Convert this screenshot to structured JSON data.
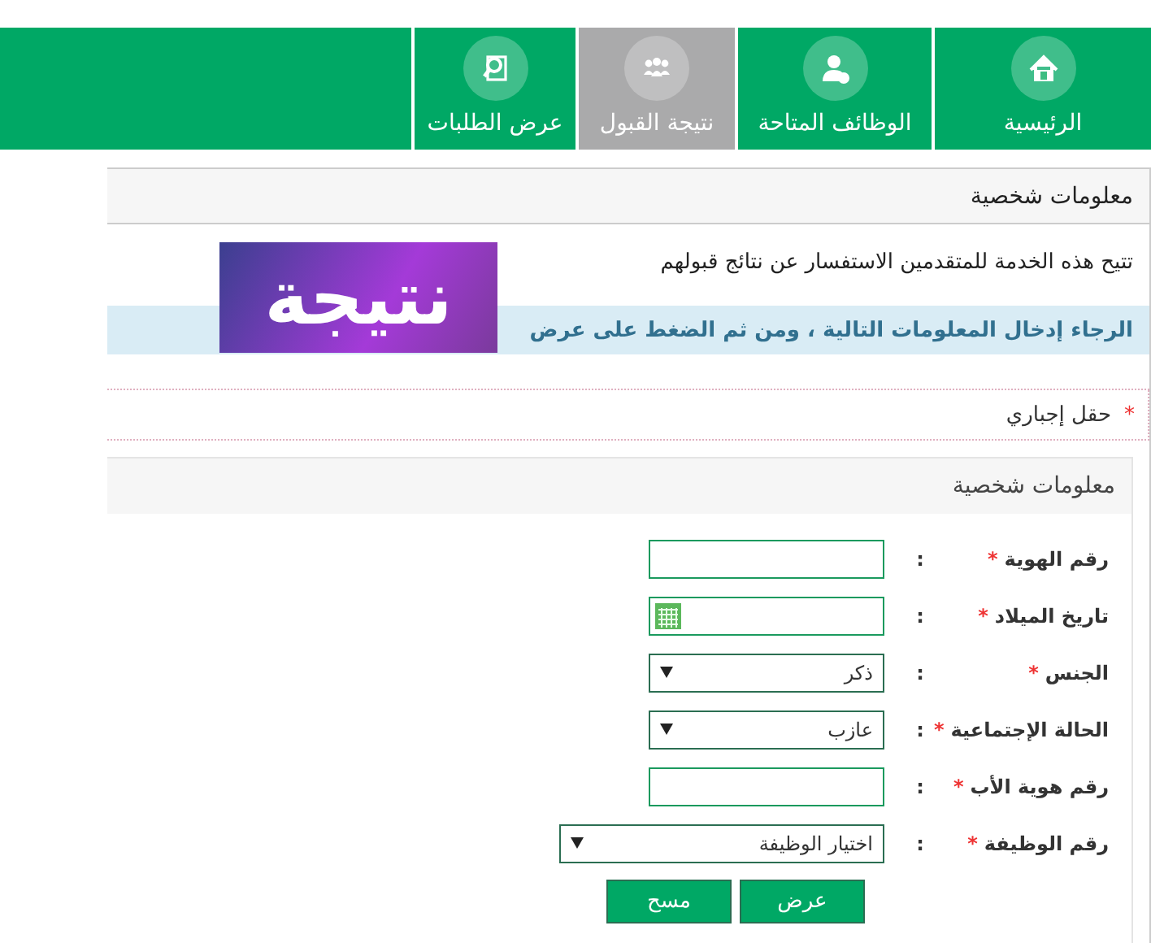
{
  "nav": {
    "items": [
      {
        "label": "الرئيسية",
        "kind": "home",
        "selected": false
      },
      {
        "label": "الوظائف المتاحة",
        "kind": "user",
        "selected": false
      },
      {
        "label": "نتيجة القبول",
        "kind": "group",
        "selected": true
      },
      {
        "label": "عرض الطلبات",
        "kind": "search",
        "selected": false
      }
    ]
  },
  "panel": {
    "title": "معلومات شخصية",
    "intro": "تتيح هذه الخدمة للمتقدمين الاستفسار عن نتائج قبولهم",
    "info": "الرجاء إدخال المعلومات التالية ، ومن ثم الضغط على عرض",
    "logo_text": "نتيجة",
    "required_note": {
      "mark": "*",
      "text": "حقل إجباري"
    }
  },
  "form": {
    "title": "معلومات شخصية",
    "fields": [
      {
        "label": "رقم الهوية",
        "required": true,
        "kind": "text"
      },
      {
        "label": "تاريخ الميلاد",
        "required": true,
        "kind": "date"
      },
      {
        "label": "الجنس",
        "required": true,
        "kind": "select",
        "value": "ذكر"
      },
      {
        "label": "الحالة الإجتماعية",
        "required": true,
        "kind": "select",
        "value": "عازب"
      },
      {
        "label": "رقم هوية الأب",
        "required": true,
        "kind": "text"
      },
      {
        "label": "رقم الوظيفة",
        "required": true,
        "kind": "select-wide",
        "value": "اختيار الوظيفة"
      }
    ],
    "colon": ":",
    "buttons": [
      "عرض",
      "مسح"
    ]
  }
}
